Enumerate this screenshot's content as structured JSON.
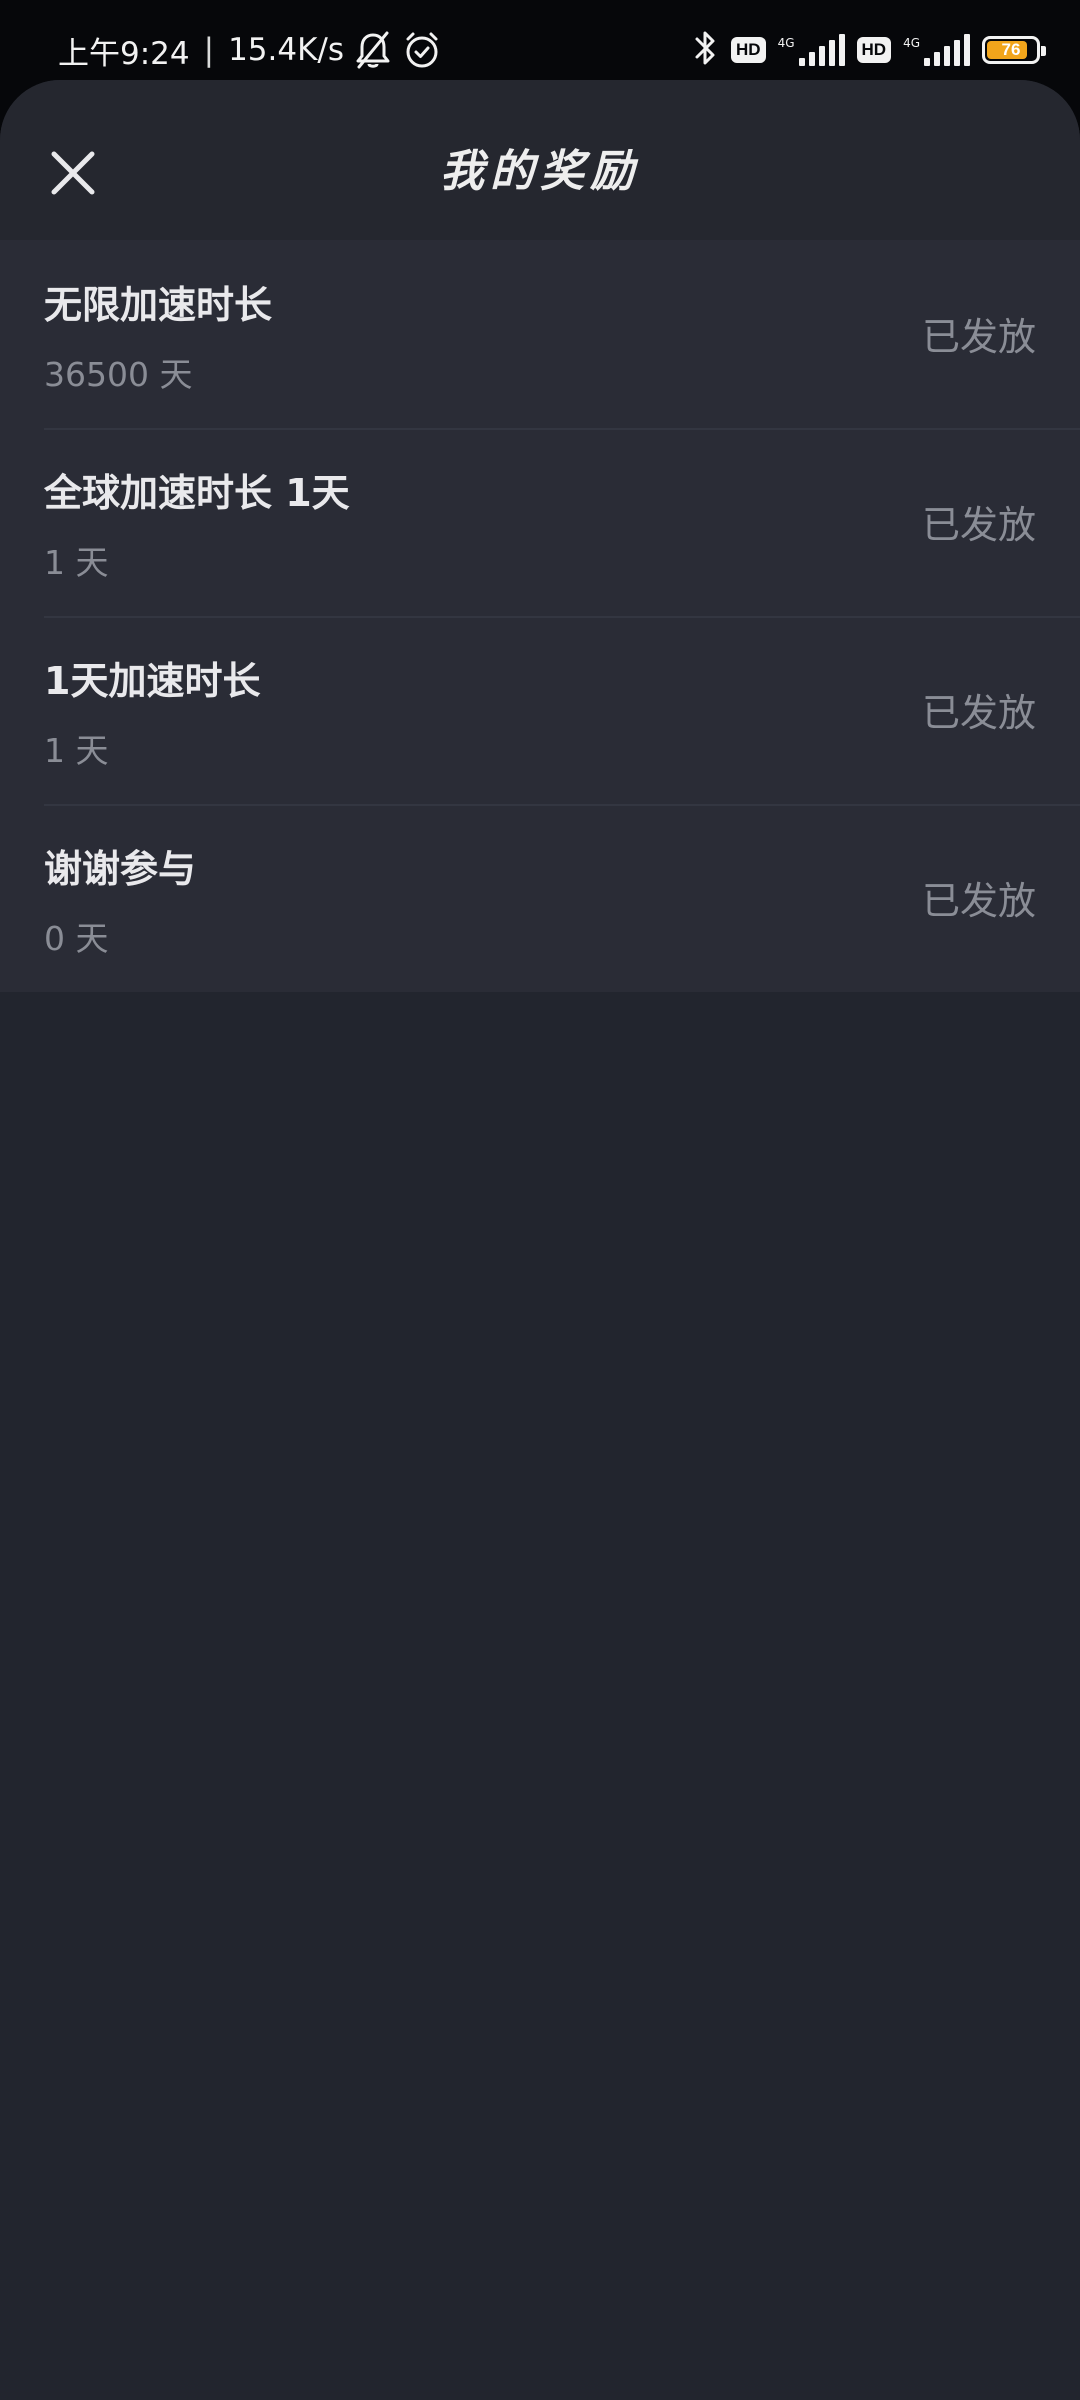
{
  "status_bar": {
    "time": "上午9:24",
    "separator": "|",
    "network_speed": "15.4K/s",
    "icons_left": [
      "bell-off-icon",
      "alarm-icon"
    ],
    "icons_right": [
      "bluetooth-icon",
      "hd-badge",
      "signal-4g-icon",
      "hd-badge",
      "signal-4g-icon",
      "battery-icon"
    ],
    "hd_label": "HD",
    "network_type": "4G",
    "battery_level": "76",
    "battery_color": "#f2a51b"
  },
  "header": {
    "title": "我的奖励",
    "close_icon": "close-icon"
  },
  "rewards": [
    {
      "name": "无限加速时长",
      "duration": "36500 天",
      "status": "已发放"
    },
    {
      "name": "全球加速时长 1天",
      "duration": "1 天",
      "status": "已发放"
    },
    {
      "name": "1天加速时长",
      "duration": "1 天",
      "status": "已发放"
    },
    {
      "name": "谢谢参与",
      "duration": "0 天",
      "status": "已发放"
    }
  ],
  "colors": {
    "background": "#22252e",
    "list_background": "#2a2c36",
    "primary_text": "#e9e9ec",
    "secondary_text": "#8a8d96"
  }
}
